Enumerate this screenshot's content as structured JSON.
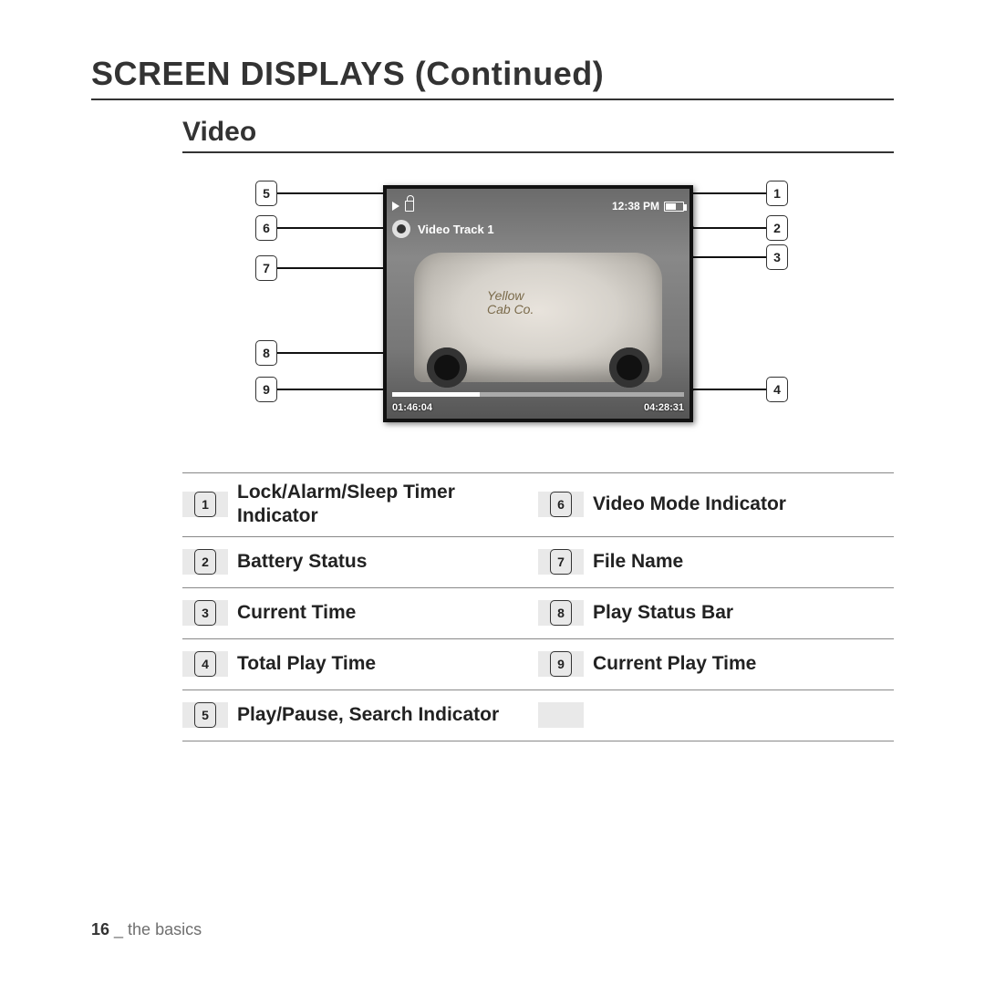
{
  "title": "SCREEN DISPLAYS (Continued)",
  "subtitle": "Video",
  "screen": {
    "file_name": "Video Track 1",
    "current_time_clock": "12:38 PM",
    "elapsed": "01:46:04",
    "total": "04:28:31",
    "car_label_line1": "Yellow",
    "car_label_line2": "Cab Co."
  },
  "callouts_left": [
    {
      "n": "5"
    },
    {
      "n": "6"
    },
    {
      "n": "7"
    },
    {
      "n": "8"
    },
    {
      "n": "9"
    }
  ],
  "callouts_right": [
    {
      "n": "1"
    },
    {
      "n": "2"
    },
    {
      "n": "3"
    },
    {
      "n": "4"
    }
  ],
  "legend_left": [
    {
      "n": "1",
      "t": "Lock/Alarm/Sleep Timer Indicator"
    },
    {
      "n": "2",
      "t": "Battery Status"
    },
    {
      "n": "3",
      "t": "Current Time"
    },
    {
      "n": "4",
      "t": "Total Play Time"
    },
    {
      "n": "5",
      "t": "Play/Pause, Search Indicator"
    }
  ],
  "legend_right": [
    {
      "n": "6",
      "t": "Video Mode Indicator"
    },
    {
      "n": "7",
      "t": "File Name"
    },
    {
      "n": "8",
      "t": "Play Status Bar"
    },
    {
      "n": "9",
      "t": "Current Play Time"
    },
    {
      "n": "",
      "t": ""
    }
  ],
  "footer": {
    "page": "16",
    "sep": " _ ",
    "section": "the basics"
  }
}
